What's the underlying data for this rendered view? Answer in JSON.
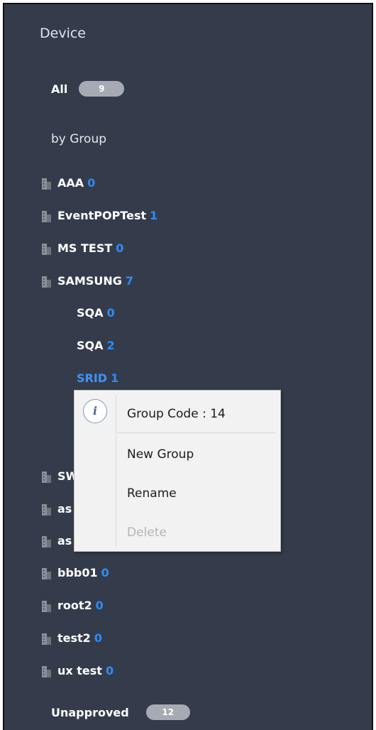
{
  "panel": {
    "title": "Device",
    "all": {
      "label": "All",
      "count": "9"
    },
    "by_group_label": "by Group",
    "unapproved": {
      "label": "Unapproved",
      "count": "12"
    }
  },
  "groups": {
    "aaa": {
      "name": "AAA",
      "count": "0"
    },
    "eventpoptest": {
      "name": "EventPOPTest",
      "count": "1"
    },
    "ms_test": {
      "name": "MS TEST",
      "count": "0"
    },
    "samsung": {
      "name": "SAMSUNG",
      "count": "7"
    },
    "samsung_sqa_1": {
      "name": "SQA",
      "count": "0"
    },
    "samsung_sqa_2": {
      "name": "SQA",
      "count": "2"
    },
    "samsung_srid": {
      "name": "SRID",
      "count": "1"
    },
    "sw_partial": {
      "name": "SW"
    },
    "as_partial_1": {
      "name": "as"
    },
    "as_partial_2": {
      "name": "as"
    },
    "bbb01": {
      "name": "bbb01",
      "count": "0"
    },
    "root2": {
      "name": "root2",
      "count": "0"
    },
    "test2": {
      "name": "test2",
      "count": "0"
    },
    "ux_test": {
      "name": "ux test",
      "count": "0"
    }
  },
  "context_menu": {
    "info_icon": "info-icon",
    "group_code": "Group Code : 14",
    "new_group": "New Group",
    "rename": "Rename",
    "delete": "Delete"
  },
  "colors": {
    "panel_bg": "#343c4c",
    "count_blue": "#2f8cf3",
    "pill_bg": "#a6abb3",
    "menu_bg": "#f2f2f2",
    "disabled_text": "#b5b5b5"
  }
}
